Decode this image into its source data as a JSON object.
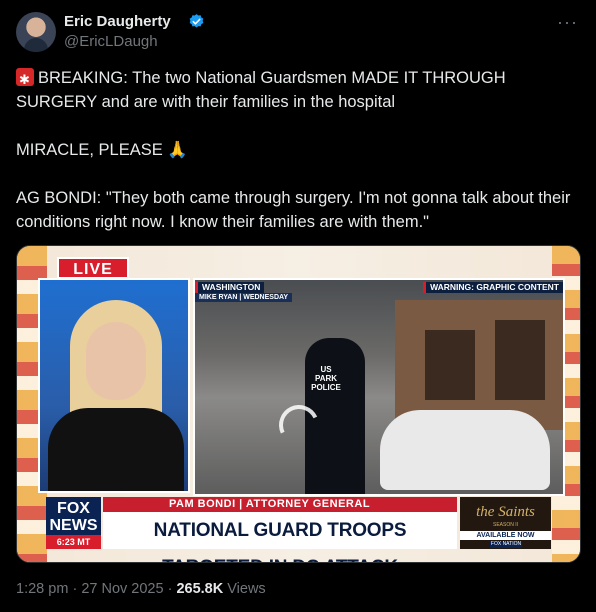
{
  "author": {
    "name": "Eric Daugherty",
    "handle": "@EricLDaugh",
    "verified_icon": "verified-badge-icon",
    "verified_color": "#1d9bf0"
  },
  "more_label": "···",
  "tweet": {
    "line1": "BREAKING: The two National Guardsmen MADE IT THROUGH SURGERY and are with their families in the hospital",
    "line2": "MIRACLE, PLEASE",
    "line3": "AG BONDI: \"They both came through surgery. I'm not gonna talk about their conditions right now. I know their families are with them.\"",
    "emoji_siren": "siren-icon",
    "emoji_pray": "🙏"
  },
  "media": {
    "live_label": "LIVE",
    "location_tag": "WASHINGTON",
    "reporter_tag": "MIKE RYAN | WEDNESDAY",
    "warning_tag": "WARNING: GRAPHIC CONTENT",
    "police_text": "US PARK POLICE",
    "lower_third_sub": "PAM BONDI | ATTORNEY GENERAL",
    "lower_third_main": "NATIONAL GUARD TROOPS TARGETED IN DC ATTACK",
    "network_logo": "FOX NEWS",
    "network_time": "6:23 MT",
    "ad_title": "the Saints",
    "ad_season": "SEASON II",
    "ad_available": "AVAILABLE NOW",
    "ad_network": "FOX NATION"
  },
  "meta": {
    "time": "1:28 pm",
    "sep1": "·",
    "date": "27 Nov 2025",
    "sep2": "·",
    "views_count": "265.8K",
    "views_label": "Views"
  },
  "colors": {
    "background": "#000000",
    "text": "#e7e9ea",
    "muted": "#71767b",
    "accent": "#1d9bf0"
  }
}
